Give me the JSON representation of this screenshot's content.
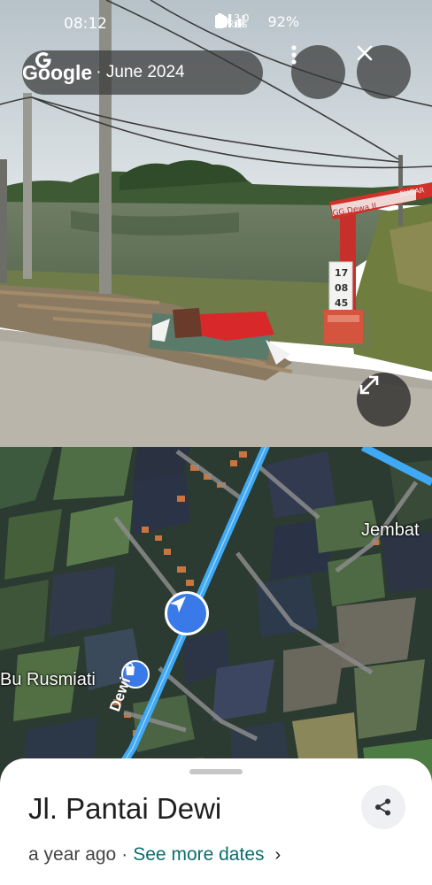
{
  "status_bar": {
    "time": "08:12",
    "net_speed_value": "13.0",
    "net_speed_unit": "KB/S",
    "battery": "92%"
  },
  "header": {
    "brand": "Google",
    "date": "· June 2024",
    "icons": {
      "brand": "google-g-icon",
      "menu": "more-vert-icon",
      "close": "close-icon"
    }
  },
  "scene": {
    "sign_text": "GG.Dewa II",
    "arch_text": "SUGAR",
    "marker_lines": [
      "17",
      "08",
      "45"
    ]
  },
  "map": {
    "labels": {
      "place_1": "Jembat",
      "poi": "Bu Rusmiati",
      "road": "Dewi"
    },
    "icons": {
      "you_are_here": "navigation-arrow-icon",
      "poi": "shopping-bag-icon"
    },
    "colors": {
      "route": "#3fa9f5",
      "marker": "#3a7ae8"
    }
  },
  "sheet": {
    "street_name": "Jl. Pantai Dewi",
    "age": "a year ago",
    "separator": "·",
    "see_more": "See more dates",
    "chevron": "›",
    "icons": {
      "share": "share-icon",
      "chevron": "chevron-right-icon"
    }
  }
}
